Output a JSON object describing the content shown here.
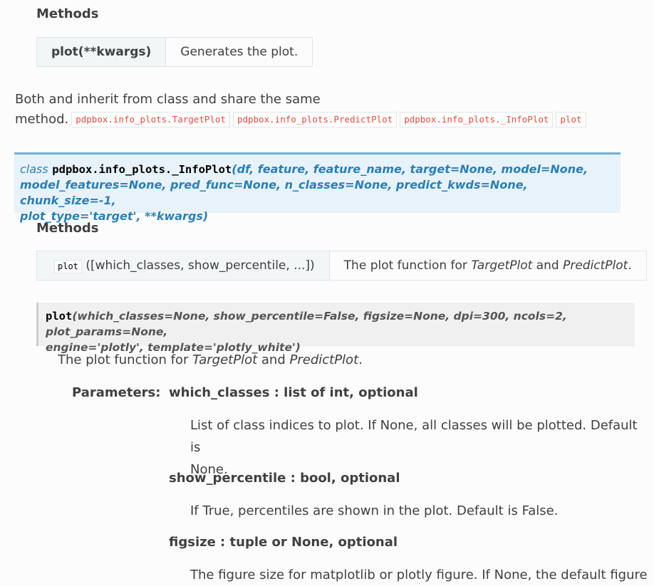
{
  "methods_top": {
    "heading": "Methods",
    "rows": [
      {
        "name": "plot(**kwargs)",
        "desc": "Generates the plot."
      }
    ]
  },
  "inherit": {
    "line1": "Both and inherit from class and share the same",
    "line2": "method.",
    "refs": [
      "pdpbox.info_plots.TargetPlot",
      "pdpbox.info_plots.PredictPlot",
      "pdpbox.info_plots._InfoPlot",
      "plot"
    ]
  },
  "class_sig": {
    "keyword": "class",
    "name": "pdpbox.info_plots._InfoPlot",
    "params_line1": "(df, feature, feature_name, target=None, model=None,",
    "params_line2": "model_features=None, pred_func=None, n_classes=None, predict_kwds=None, chunk_size=-1,",
    "params_line3": "plot_type='target', **kwargs)"
  },
  "methods_class": {
    "heading": "Methods",
    "row": {
      "code": "plot",
      "args": "([which_classes, show_percentile, ...])",
      "desc_prefix": "The plot function for ",
      "desc_target": "TargetPlot",
      "desc_and": " and ",
      "desc_predict": "PredictPlot",
      "desc_suffix": "."
    }
  },
  "method_sig": {
    "name": "plot",
    "params_line1": "(which_classes=None, show_percentile=False, figsize=None, dpi=300, ncols=2, plot_params=None,",
    "params_line2": "engine='plotly', template='plotly_white')"
  },
  "method_desc": {
    "prefix": "The plot function for ",
    "target": "TargetPlot",
    "and": " and ",
    "predict": "PredictPlot",
    "suffix": "."
  },
  "parameters": {
    "label": "Parameters:",
    "items": [
      {
        "type": "which_classes : list of int, optional",
        "desc1": "List of class indices to plot. If None, all classes will be plotted. Default is",
        "desc2": "None."
      },
      {
        "type": "show_percentile : bool, optional",
        "desc1": "If True, percentiles are shown in the plot. Default is False."
      },
      {
        "type": "figsize : tuple or None, optional",
        "desc1": "The figure size for matplotlib or plotly figure. If None, the default figure"
      }
    ]
  }
}
